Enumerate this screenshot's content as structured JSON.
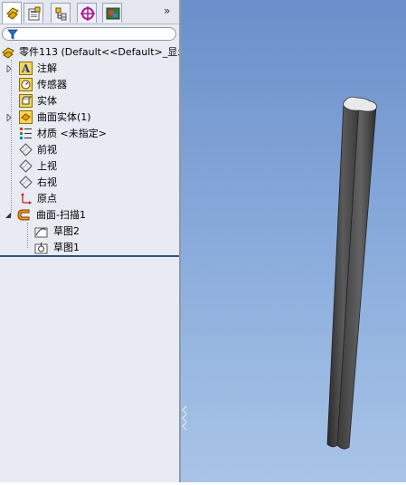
{
  "tabs": [
    {
      "icon": "feature-manager-icon",
      "active": true
    },
    {
      "icon": "property-manager-icon",
      "active": false
    },
    {
      "icon": "configuration-manager-icon",
      "active": false
    },
    {
      "icon": "dimxpert-icon",
      "active": false
    },
    {
      "icon": "display-manager-icon",
      "active": false
    }
  ],
  "overflow_label": "»",
  "tree": {
    "root": "零件113  (Default<<Default>_显示",
    "items": [
      {
        "label": "注解",
        "icon": "annotations-icon"
      },
      {
        "label": "传感器",
        "icon": "sensors-icon"
      },
      {
        "label": "实体",
        "icon": "solid-bodies-icon"
      },
      {
        "label": "曲面实体(1)",
        "icon": "surface-bodies-icon"
      },
      {
        "label": "材质 <未指定>",
        "icon": "material-icon"
      },
      {
        "label": "前视",
        "icon": "plane-icon"
      },
      {
        "label": "上视",
        "icon": "plane-icon"
      },
      {
        "label": "右视",
        "icon": "plane-icon"
      },
      {
        "label": "原点",
        "icon": "origin-icon"
      },
      {
        "label": "曲面-扫描1",
        "icon": "surface-sweep-icon"
      },
      {
        "label": "草图2",
        "icon": "sketch-icon"
      },
      {
        "label": "草图1",
        "icon": "sketch-icon"
      }
    ]
  },
  "colors": {
    "viewport_top": "#6b8fca",
    "viewport_bottom": "#a9c4e6",
    "panel": "#e9ebf3",
    "model": "#4a4a4a"
  }
}
